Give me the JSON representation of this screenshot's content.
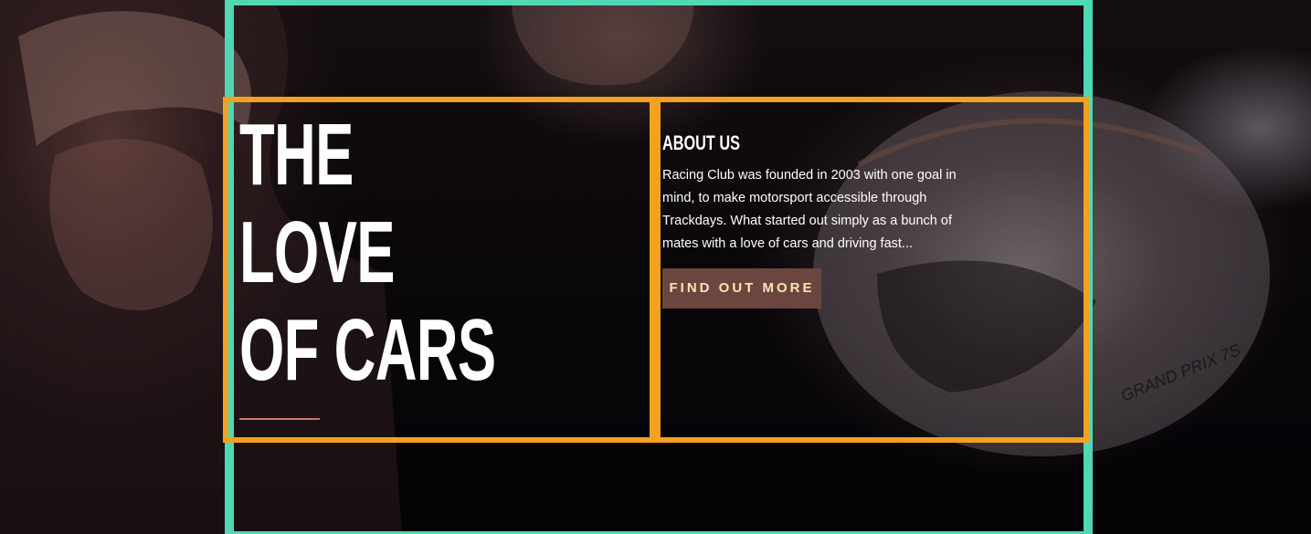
{
  "hero": {
    "headline": {
      "line1": "THE",
      "line2": "LOVE",
      "line3": "OF CARS"
    },
    "helmet_text": "GRAND PRIX 7S"
  },
  "about": {
    "title": "ABOUT US",
    "text": "Racing Club was founded in 2003 with one goal in mind, to make motorsport accessible through Trackdays.  What started out simply as a bunch of mates with a love of cars and driving fast...",
    "button_label": "FIND OUT MORE"
  },
  "colors": {
    "background": "#070508",
    "outer_frame": "#4fd8b4",
    "inner_frame": "#f3a11f",
    "button_bg": "#6b4640",
    "button_text": "#f6e7b4",
    "underline": "#c97a66"
  }
}
